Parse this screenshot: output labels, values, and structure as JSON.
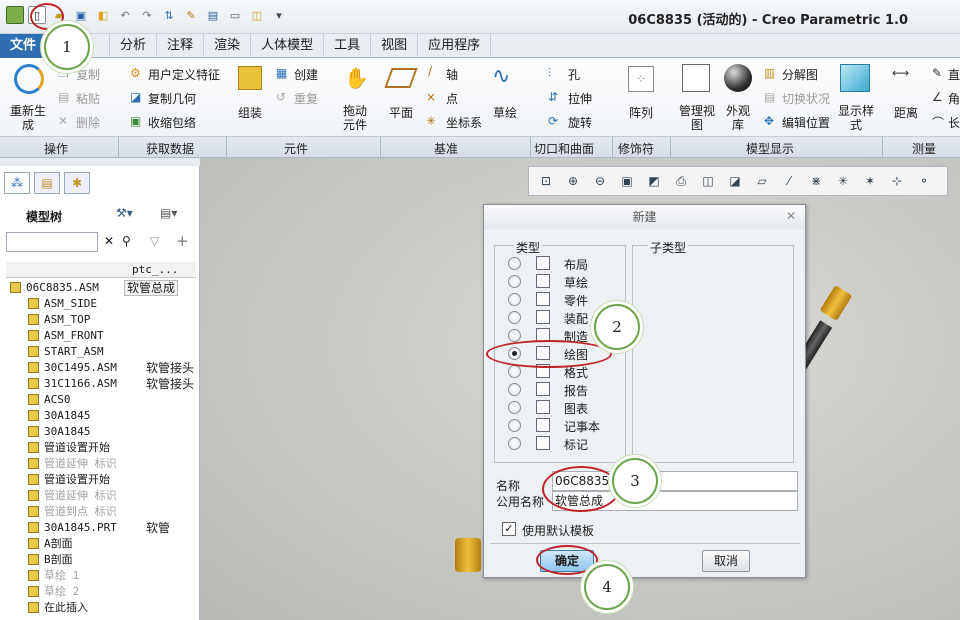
{
  "window": {
    "title": "06C8835 (活动的) - Creo Parametric 1.0"
  },
  "tabs": [
    "文件",
    "模型",
    "分析",
    "注释",
    "渲染",
    "人体模型",
    "工具",
    "视图",
    "应用程序"
  ],
  "ribbon": {
    "regen": "重新生成",
    "copy": "复制",
    "paste": "粘贴",
    "delete": "删除",
    "udf": "用户定义特征",
    "copy_geom": "复制几何",
    "shrinkwrap": "收缩包络",
    "assemble": "组装",
    "create": "创建",
    "repeat": "重复",
    "drag": "拖动元件",
    "plane": "平面",
    "axis": "轴",
    "point": "点",
    "csys": "坐标系",
    "sketch": "草绘",
    "hole": "孔",
    "extrude": "拉伸",
    "revolve": "旋转",
    "pattern": "阵列",
    "manage_views": "管理视图",
    "appearance": "外观库",
    "exploded": "分解图",
    "toggle_state": "切换状况",
    "edit_position": "编辑位置",
    "display_style": "显示样式",
    "distance": "距离",
    "line": "直",
    "angle": "角",
    "length": "长"
  },
  "groups": [
    "操作",
    "获取数据",
    "元件",
    "基准",
    "切口和曲面",
    "修饰符",
    "模型显示",
    "测量"
  ],
  "model_tree": {
    "title": "模型树",
    "col_header": "ptc_...",
    "root": "06C8835.ASM",
    "root_value": "软管总成",
    "rows": [
      {
        "name": "ASM_SIDE",
        "value": "",
        "dim": false
      },
      {
        "name": "ASM_TOP",
        "value": "",
        "dim": false
      },
      {
        "name": "ASM_FRONT",
        "value": "",
        "dim": false
      },
      {
        "name": "START_ASM",
        "value": "",
        "dim": false
      },
      {
        "name": "30C1495.ASM",
        "value": "软管接头",
        "dim": false
      },
      {
        "name": "31C1166.ASM",
        "value": "软管接头",
        "dim": false
      },
      {
        "name": "ACS0",
        "value": "",
        "dim": false
      },
      {
        "name": "30A1845",
        "value": "",
        "dim": false
      },
      {
        "name": "30A1845",
        "value": "",
        "dim": false
      },
      {
        "name": "管道设置开始",
        "value": "",
        "dim": false
      },
      {
        "name": "管道延伸 标识",
        "value": "",
        "dim": true
      },
      {
        "name": "管道设置开始",
        "value": "",
        "dim": false
      },
      {
        "name": "管道延伸 标识",
        "value": "",
        "dim": true
      },
      {
        "name": "管道到点 标识",
        "value": "",
        "dim": true
      },
      {
        "name": "30A1845.PRT",
        "value": "软管",
        "dim": false
      },
      {
        "name": "A剖面",
        "value": "",
        "dim": false
      },
      {
        "name": "B剖面",
        "value": "",
        "dim": false
      },
      {
        "name": "草绘 1",
        "value": "",
        "dim": true
      },
      {
        "name": "草绘 2",
        "value": "",
        "dim": true
      },
      {
        "name": "在此插入",
        "value": "",
        "dim": false
      }
    ]
  },
  "dialog": {
    "title": "新建",
    "type_label": "类型",
    "subtype_label": "子类型",
    "types": [
      "布局",
      "草绘",
      "零件",
      "装配",
      "制造",
      "绘图",
      "格式",
      "报告",
      "图表",
      "记事本",
      "标记"
    ],
    "selected_index": 5,
    "name_label": "名称",
    "name_value": "06C8835",
    "common_label": "公用名称",
    "common_value": "软管总成",
    "use_template": "使用默认模板",
    "ok": "确定",
    "cancel": "取消"
  },
  "callouts": [
    "1",
    "2",
    "3",
    "4"
  ],
  "colors": {
    "accent": "#2f6fb1",
    "callout_border": "#6da34d",
    "highlight": "#c0232a"
  }
}
